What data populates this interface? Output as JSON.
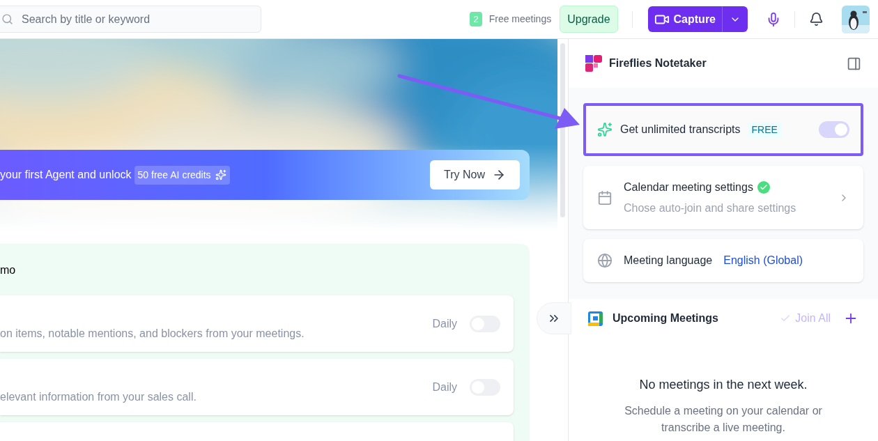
{
  "search": {
    "placeholder": "Search by title or keyword"
  },
  "top_bar": {
    "free_count": "2",
    "free_label": "Free meetings",
    "upgrade": "Upgrade",
    "capture": "Capture"
  },
  "banner": {
    "text": "your first Agent and unlock",
    "credits": "50 free AI credits",
    "button": "Try Now"
  },
  "section": {
    "title": "mo",
    "rows": [
      {
        "description": "on items, notable mentions, and blockers from your meetings.",
        "frequency": "Daily",
        "on": false
      },
      {
        "description": "elevant information from your sales call.",
        "frequency": "Daily",
        "on": false
      }
    ]
  },
  "panel": {
    "title": "Fireflies Notetaker",
    "transcripts": {
      "label": "Get unlimited transcripts",
      "badge": "FREE",
      "on": true
    },
    "calendar": {
      "title": "Calendar meeting settings",
      "subtitle": "Chose auto-join and share settings",
      "verified": true
    },
    "language": {
      "label": "Meeting language",
      "value": "English (Global)"
    },
    "upcoming": {
      "title": "Upcoming Meetings",
      "join_all": "Join All",
      "empty_title": "No meetings in the next week.",
      "empty_text": "Schedule a meeting on your calendar or transcribe a live meeting."
    }
  }
}
